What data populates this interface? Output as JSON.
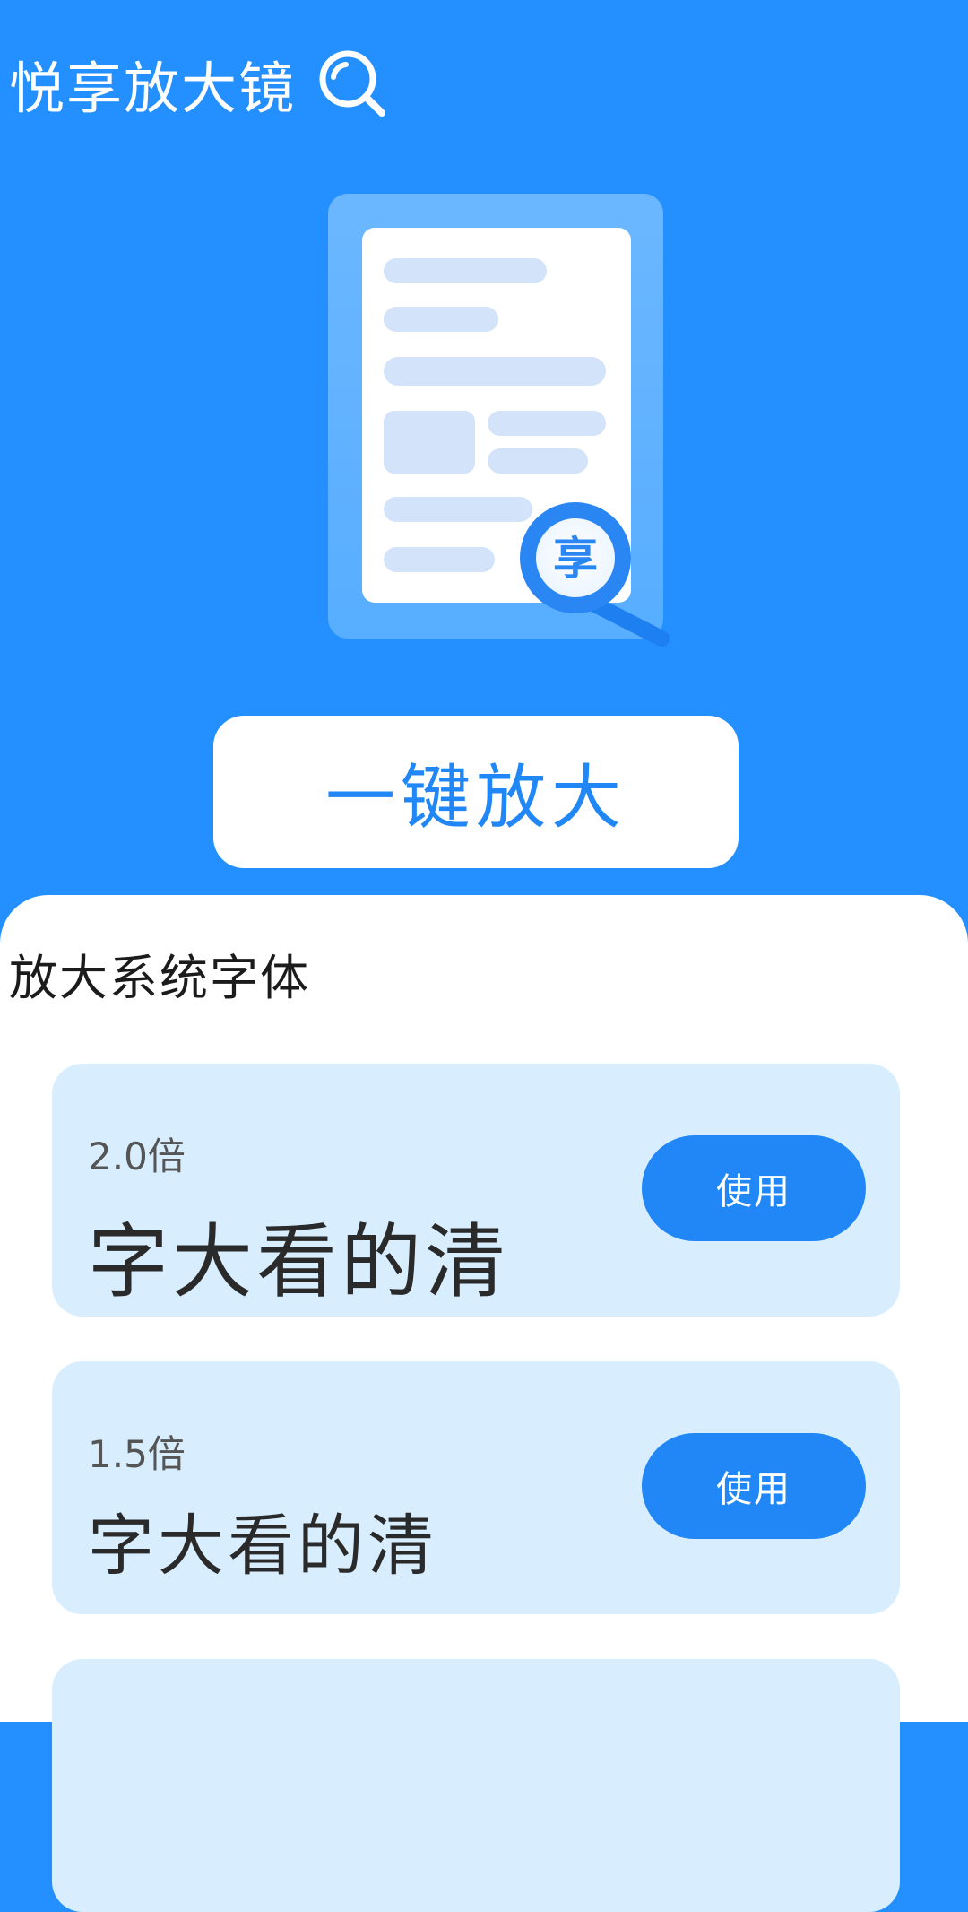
{
  "app": {
    "title": "悦享放大镜"
  },
  "hero": {
    "magnifier_glyph": "享",
    "one_tap_label": "一键放大"
  },
  "section": {
    "title": "放大系统字体"
  },
  "options": [
    {
      "scale": "2.0倍",
      "sample": "字大看的清",
      "button": "使用"
    },
    {
      "scale": "1.5倍",
      "sample": "字大看的清",
      "button": "使用"
    }
  ],
  "colors": {
    "primary": "#2490FF",
    "button_blue": "#2187F6",
    "card_bg": "#D8EEFF",
    "white": "#FFFFFF"
  },
  "icons": {
    "title": "magnifier-icon",
    "hero": "document-magnifier-illustration"
  }
}
